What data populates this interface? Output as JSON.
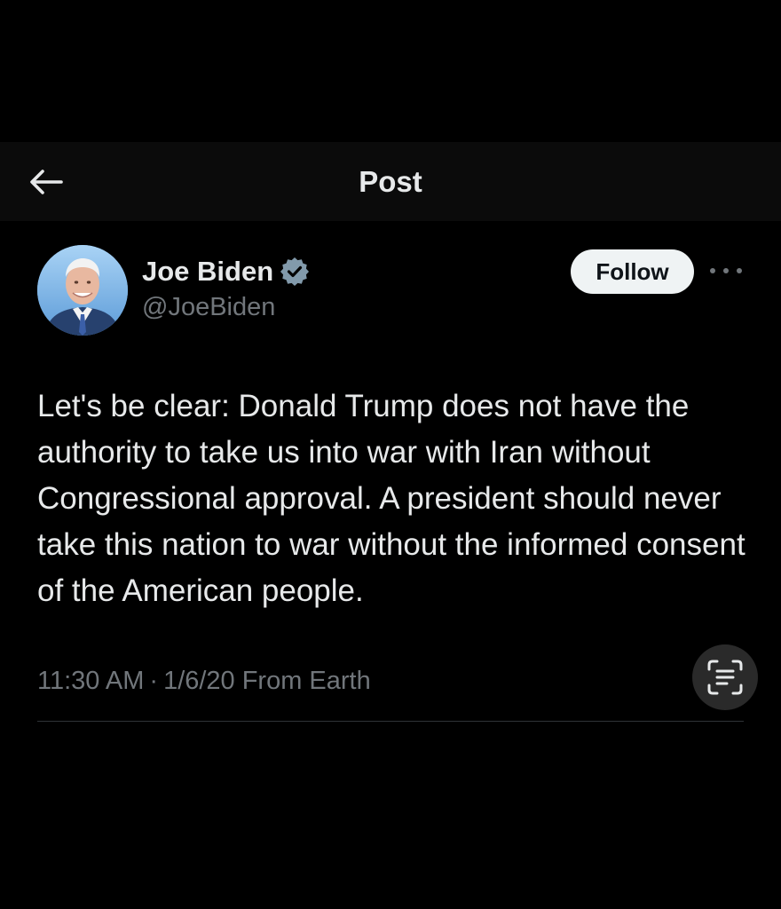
{
  "header": {
    "title": "Post",
    "back_icon": "arrow-left-icon"
  },
  "author": {
    "name": "Joe Biden",
    "handle": "@JoeBiden",
    "verified": true,
    "avatar_icon": "profile-photo",
    "follow_label": "Follow",
    "more_icon": "more-horizontal-icon"
  },
  "tweet": {
    "text": "Let's be clear: Donald Trump does not have the authority to take us into war with Iran without Congressional approval. A president should never take this nation to war without the informed consent of the American people.",
    "time": "11:30 AM",
    "separator": "·",
    "date": "1/6/20",
    "source": "From Earth",
    "scan_icon": "text-scan-icon"
  },
  "colors": {
    "background": "#000000",
    "header_background": "#0b0b0b",
    "primary_text": "#e7e9ea",
    "secondary_text": "#71767b",
    "verified_badge": "#829aab",
    "follow_button_bg": "#eff3f4"
  }
}
